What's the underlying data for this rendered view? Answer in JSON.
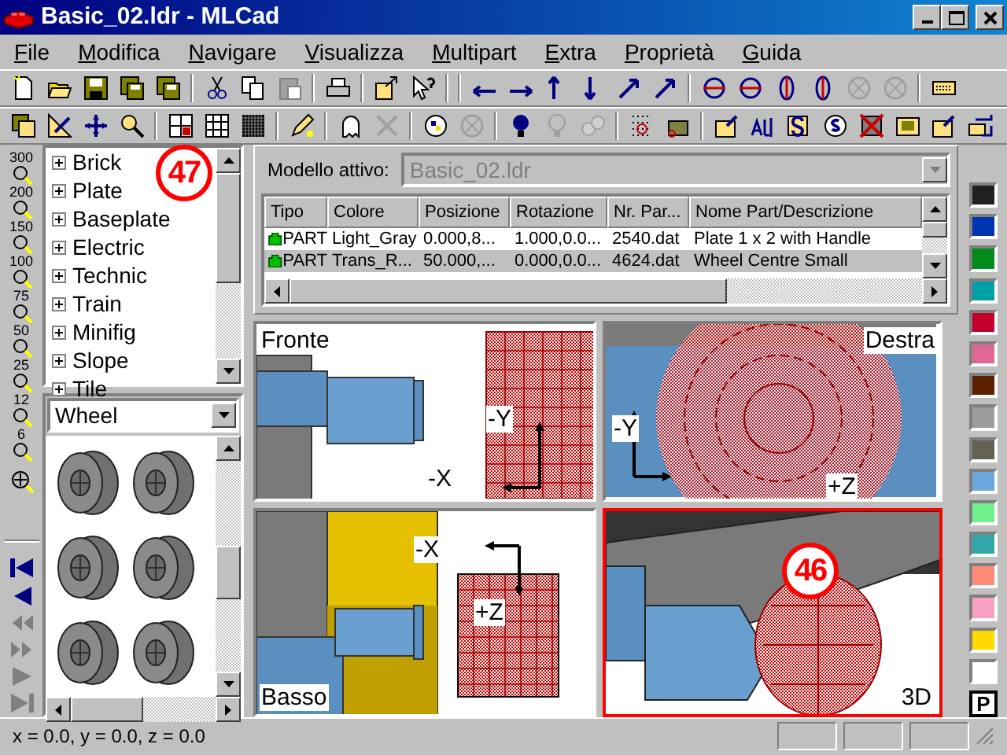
{
  "window": {
    "title": "Basic_02.ldr - MLCad"
  },
  "menu": [
    "File",
    "Modifica",
    "Navigare",
    "Visualizza",
    "Multipart",
    "Extra",
    "Proprietà",
    "Guida"
  ],
  "zoom_buttons": [
    "300",
    "200",
    "150",
    "100",
    "75",
    "50",
    "25",
    "12",
    "6"
  ],
  "nav_buttons": [
    {
      "disabled": false
    },
    {
      "disabled": false
    },
    {
      "disabled": true
    },
    {
      "disabled": true
    },
    {
      "disabled": true
    },
    {
      "disabled": true
    }
  ],
  "tree": {
    "callout": "47",
    "items": [
      {
        "label": "Brick",
        "expanded": false
      },
      {
        "label": "Plate",
        "expanded": false
      },
      {
        "label": "Baseplate",
        "expanded": false
      },
      {
        "label": "Electric",
        "expanded": false
      },
      {
        "label": "Technic",
        "expanded": false
      },
      {
        "label": "Train",
        "expanded": false
      },
      {
        "label": "Minifig",
        "expanded": false
      },
      {
        "label": "Slope",
        "expanded": false
      },
      {
        "label": "Tile",
        "expanded": false
      }
    ]
  },
  "part_filter": {
    "value": "Wheel"
  },
  "model": {
    "label": "Modello attivo:",
    "value": "Basic_02.ldr"
  },
  "table": {
    "columns": [
      "Tipo",
      "Colore",
      "Posizione",
      "Rotazione",
      "Nr. Par...",
      "Nome Part/Descrizione"
    ],
    "rows": [
      {
        "selected": false,
        "cells": [
          "PART",
          "Light_Gray",
          "0.000,8...",
          "1.000,0.0...",
          "2540.dat",
          "Plate  1 x  2 with Handle"
        ]
      },
      {
        "selected": true,
        "cells": [
          "PART",
          "Trans_R...",
          "50.000,...",
          "0.000,0.0...",
          "4624.dat",
          "Wheel Centre Small"
        ]
      }
    ]
  },
  "views": [
    {
      "label": "Fronte",
      "active": false,
      "axes": [
        "-Y",
        "-X"
      ]
    },
    {
      "label": "Destra",
      "active": false,
      "axes": [
        "-Y",
        "+Z"
      ]
    },
    {
      "label": "Basso",
      "active": false,
      "axes": [
        "-X",
        "+Z"
      ]
    },
    {
      "label": "3D",
      "active": true,
      "callout": "46"
    }
  ],
  "palette": [
    {
      "color": "#202020"
    },
    {
      "color": "#0033b2"
    },
    {
      "color": "#008a1a"
    },
    {
      "color": "#00a0a8"
    },
    {
      "color": "#c4002a"
    },
    {
      "color": "#e06894"
    },
    {
      "color": "#5c2000"
    },
    {
      "color": "#9c9c9c"
    },
    {
      "color": "#646052"
    },
    {
      "color": "#6aa8dc"
    },
    {
      "color": "#6ef08c"
    },
    {
      "color": "#30a8a8"
    },
    {
      "color": "#ff8a78"
    },
    {
      "color": "#f8a0c4"
    },
    {
      "color": "#ffd800"
    },
    {
      "color": "#ffffff"
    }
  ],
  "palette_button": "P",
  "status_bar": {
    "text": "x = 0.0, y = 0.0, z = 0.0"
  }
}
